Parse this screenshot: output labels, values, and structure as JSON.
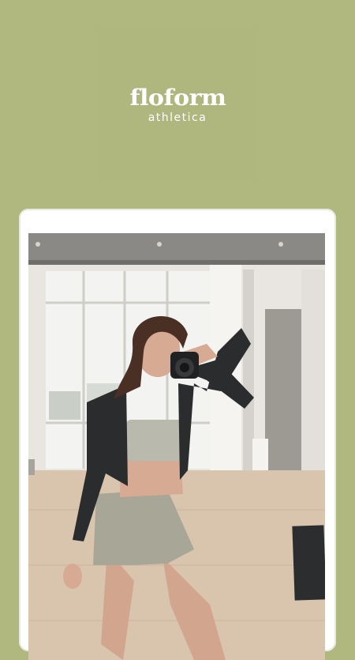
{
  "brand": {
    "wordmark": "floform",
    "tagline": "athletica"
  },
  "colors": {
    "background": "#b0b77f",
    "frame": "#ffffff",
    "logo_text": "#ffffff"
  },
  "hero_image": {
    "description_icon": "fitness-model-photo"
  }
}
